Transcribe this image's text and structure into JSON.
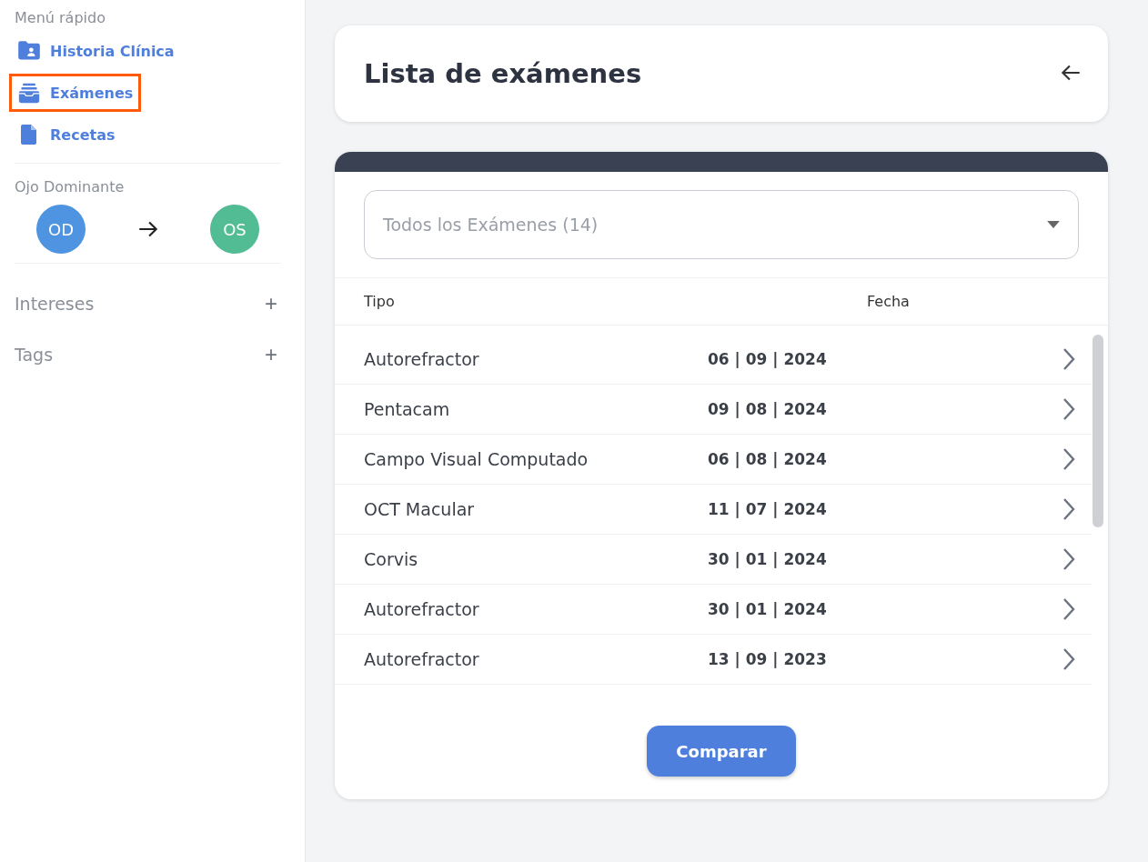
{
  "sidebar": {
    "quick_menu_title": "Menú rápido",
    "items": [
      {
        "label": "Historia Clínica",
        "kind": "record",
        "highlighted": false
      },
      {
        "label": "Exámenes",
        "kind": "exams",
        "highlighted": true
      },
      {
        "label": "Recetas",
        "kind": "prescriptions",
        "highlighted": false
      }
    ],
    "dominant_eye": {
      "title": "Ojo Dominante",
      "from": {
        "label": "OD",
        "color": "#4f94e0"
      },
      "to": {
        "label": "OS",
        "color": "#52bc95"
      }
    },
    "sections": [
      {
        "label": "Intereses",
        "action": "+"
      },
      {
        "label": "Tags",
        "action": "+"
      }
    ]
  },
  "header": {
    "title": "Lista de exámenes"
  },
  "exams": {
    "filter": {
      "value": "Todos los Exámenes (14)"
    },
    "columns": [
      "Tipo",
      "Fecha"
    ],
    "rows": [
      {
        "type": "Autorefractor",
        "date": "06 | 09 | 2024"
      },
      {
        "type": "Pentacam",
        "date": "09 | 08 | 2024"
      },
      {
        "type": "Campo Visual Computado",
        "date": "06 | 08 | 2024"
      },
      {
        "type": "OCT Macular",
        "date": "11 | 07 | 2024"
      },
      {
        "type": "Corvis",
        "date": "30 | 01 | 2024"
      },
      {
        "type": "Autorefractor",
        "date": "30 | 01 | 2024"
      },
      {
        "type": "Autorefractor",
        "date": "13 | 09 | 2023"
      }
    ],
    "compare_button": "Comparar"
  }
}
